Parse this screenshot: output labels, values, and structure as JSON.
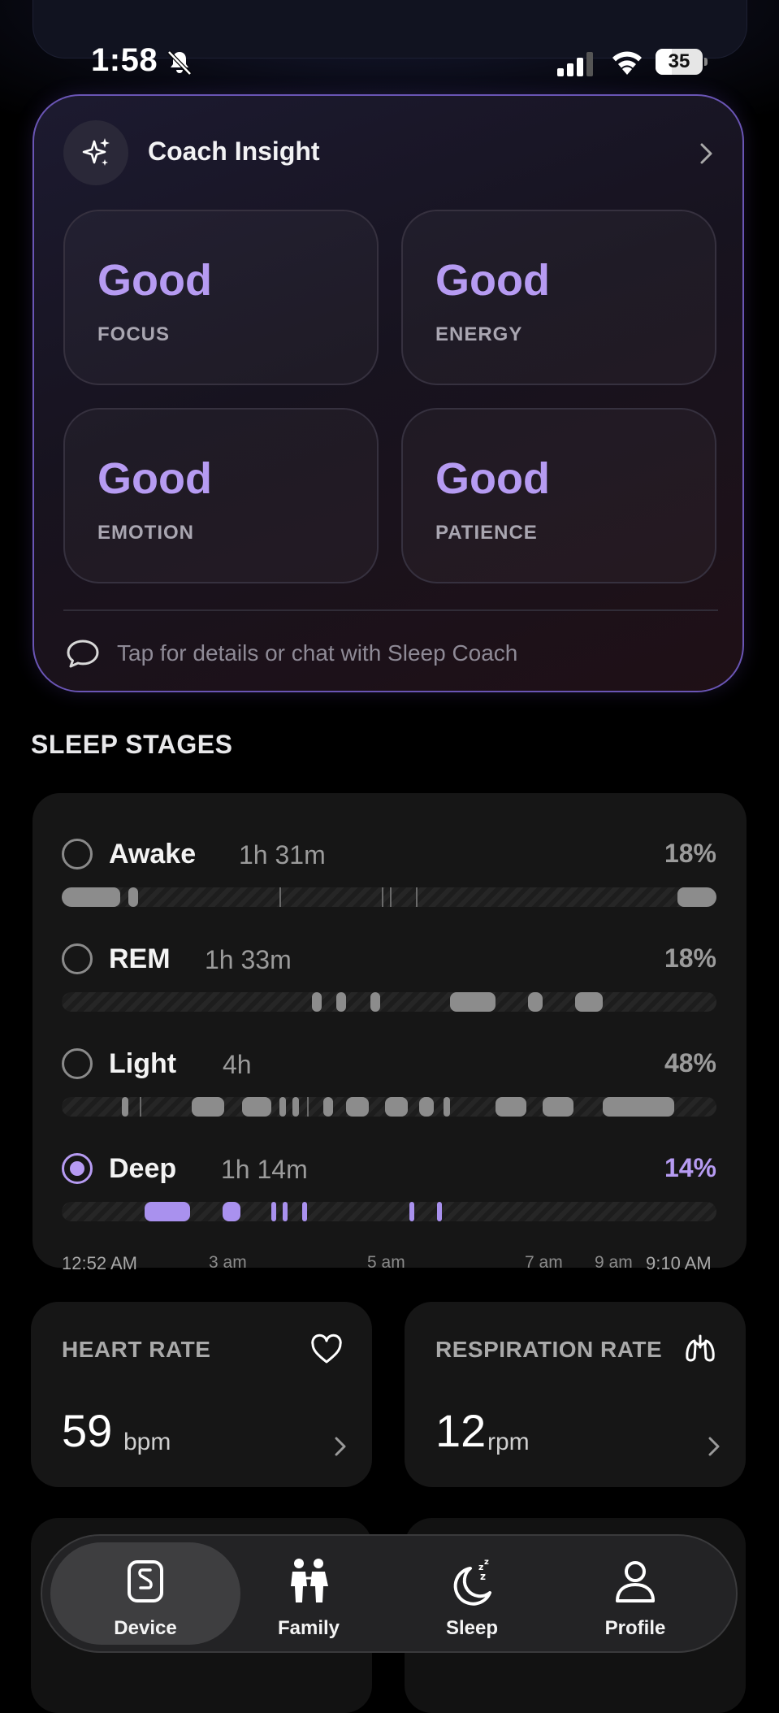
{
  "status_bar": {
    "time": "1:58",
    "battery": "35",
    "battery_fraction": 0.35
  },
  "coach_card": {
    "title": "Coach Insight",
    "metrics": [
      {
        "value": "Good",
        "label": "FOCUS"
      },
      {
        "value": "Good",
        "label": "ENERGY"
      },
      {
        "value": "Good",
        "label": "EMOTION"
      },
      {
        "value": "Good",
        "label": "PATIENCE"
      }
    ],
    "footer_text": "Tap for details or chat with Sleep Coach"
  },
  "sleep_stages": {
    "section_title": "SLEEP STAGES",
    "stages": [
      {
        "name": "Awake",
        "duration": "1h 31m",
        "percent": "18%",
        "selected": false
      },
      {
        "name": "REM",
        "duration": "1h 33m",
        "percent": "18%",
        "selected": false
      },
      {
        "name": "Light",
        "duration": "4h",
        "percent": "48%",
        "selected": false
      },
      {
        "name": "Deep",
        "duration": "1h 14m",
        "percent": "14%",
        "selected": true
      }
    ],
    "time_axis": [
      "12:52 AM",
      "3 am",
      "5 am",
      "7 am",
      "9 am",
      "9:10 AM"
    ]
  },
  "vitals": {
    "heart_rate": {
      "title": "HEART RATE",
      "value": "59",
      "unit": "bpm"
    },
    "respiration_rate": {
      "title": "RESPIRATION RATE",
      "value": "12",
      "unit": "rpm"
    }
  },
  "bottom_nav": {
    "active": "Device",
    "items": [
      {
        "label": "Device",
        "icon": "device-icon"
      },
      {
        "label": "Family",
        "icon": "family-icon"
      },
      {
        "label": "Sleep",
        "icon": "sleep-moon-icon"
      },
      {
        "label": "Profile",
        "icon": "profile-icon"
      }
    ]
  },
  "colors": {
    "accent": "#b69bf2",
    "card_border": "#6a55b5",
    "background": "#000000"
  }
}
